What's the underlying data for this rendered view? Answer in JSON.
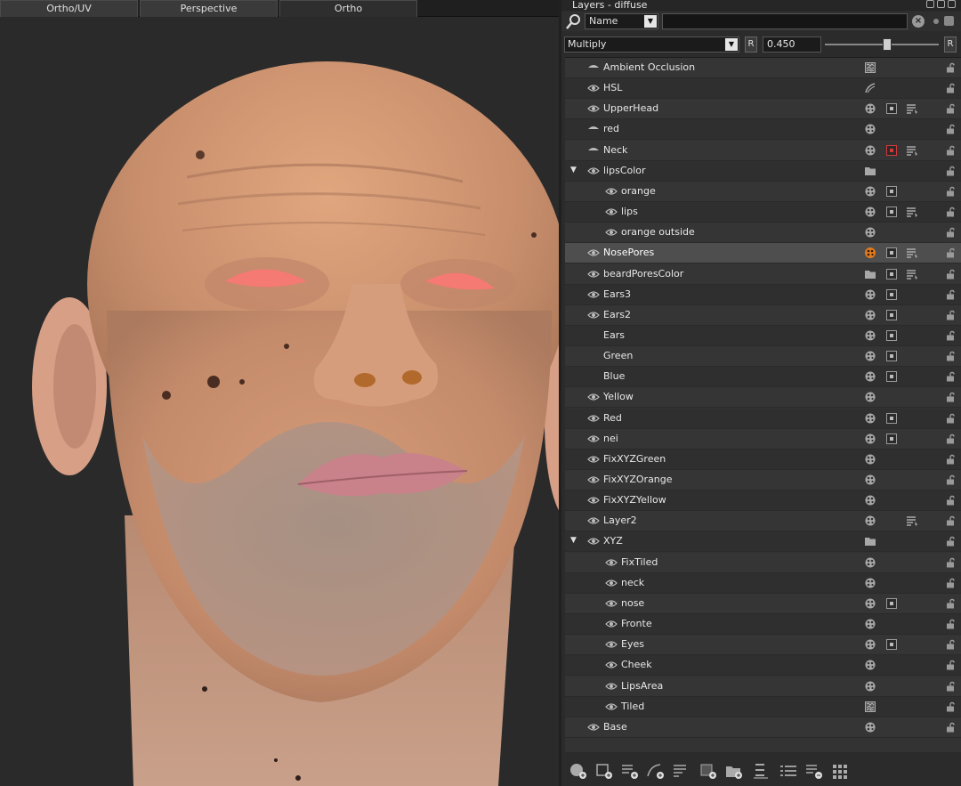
{
  "viewport": {
    "tabs": [
      {
        "label": "Ortho/UV"
      },
      {
        "label": "Perspective"
      },
      {
        "label": "Ortho"
      }
    ]
  },
  "panel": {
    "title": "Layers - diffuse",
    "filter": {
      "selected": "Name",
      "search_value": ""
    },
    "blend_mode": "Multiply",
    "reset_label": "R",
    "opacity_value": "0.450",
    "opacity_fraction": 0.45,
    "selection_color": "#4e4e4e",
    "paint_accent": "#e07a1f"
  },
  "layers": [
    {
      "name": "Ambient Occlusion",
      "indent": 0,
      "expander": "",
      "icons": [
        "texture-icon"
      ],
      "eye": "dim"
    },
    {
      "name": "HSL",
      "indent": 0,
      "expander": "",
      "icons": [
        "adjust-icon"
      ],
      "eye": "on"
    },
    {
      "name": "UpperHead",
      "indent": 0,
      "expander": "",
      "icons": [
        "paint-icon",
        "mask-icon",
        "filter-icon"
      ],
      "eye": "on"
    },
    {
      "name": "red",
      "indent": 0,
      "expander": "",
      "icons": [
        "paint-icon"
      ],
      "eye": "dim"
    },
    {
      "name": "Neck",
      "indent": 0,
      "expander": "",
      "icons": [
        "paint-icon",
        "mask-red-icon",
        "filter-icon"
      ],
      "eye": "dim"
    },
    {
      "name": "lipsColor",
      "indent": 0,
      "expander": "▼",
      "icons": [
        "folder-icon"
      ],
      "eye": "on"
    },
    {
      "name": "orange",
      "indent": 1,
      "expander": "",
      "icons": [
        "paint-icon",
        "mask-icon"
      ],
      "eye": "on"
    },
    {
      "name": "lips",
      "indent": 1,
      "expander": "",
      "icons": [
        "paint-icon",
        "mask-icon",
        "filter-icon"
      ],
      "eye": "on"
    },
    {
      "name": "orange outside",
      "indent": 1,
      "expander": "",
      "icons": [
        "paint-icon"
      ],
      "eye": "on"
    },
    {
      "name": "NosePores",
      "indent": 0,
      "expander": "",
      "icons": [
        "paint-active-icon",
        "mask-icon",
        "filter-icon"
      ],
      "eye": "on",
      "selected": true
    },
    {
      "name": "beardPoresColor",
      "indent": 0,
      "expander": "",
      "icons": [
        "folder-icon",
        "mask-icon",
        "filter-icon"
      ],
      "eye": "on"
    },
    {
      "name": "Ears3",
      "indent": 0,
      "expander": "",
      "icons": [
        "paint-icon",
        "mask-icon"
      ],
      "eye": "on"
    },
    {
      "name": "Ears2",
      "indent": 0,
      "expander": "",
      "icons": [
        "paint-icon",
        "mask-icon"
      ],
      "eye": "on"
    },
    {
      "name": "Ears",
      "indent": 0,
      "expander": "",
      "icons": [
        "paint-icon",
        "mask-icon"
      ],
      "eye": "off"
    },
    {
      "name": "Green",
      "indent": 0,
      "expander": "",
      "icons": [
        "paint-icon",
        "mask-icon"
      ],
      "eye": "off"
    },
    {
      "name": "Blue",
      "indent": 0,
      "expander": "",
      "icons": [
        "paint-icon",
        "mask-icon"
      ],
      "eye": "off"
    },
    {
      "name": "Yellow",
      "indent": 0,
      "expander": "",
      "icons": [
        "paint-icon"
      ],
      "eye": "on"
    },
    {
      "name": "Red",
      "indent": 0,
      "expander": "",
      "icons": [
        "paint-icon",
        "mask-icon"
      ],
      "eye": "on"
    },
    {
      "name": "nei",
      "indent": 0,
      "expander": "",
      "icons": [
        "paint-icon",
        "mask-icon"
      ],
      "eye": "on"
    },
    {
      "name": "FixXYZGreen",
      "indent": 0,
      "expander": "",
      "icons": [
        "paint-icon"
      ],
      "eye": "on"
    },
    {
      "name": "FixXYZOrange",
      "indent": 0,
      "expander": "",
      "icons": [
        "paint-icon"
      ],
      "eye": "on"
    },
    {
      "name": "FixXYZYellow",
      "indent": 0,
      "expander": "",
      "icons": [
        "paint-icon"
      ],
      "eye": "on"
    },
    {
      "name": "Layer2",
      "indent": 0,
      "expander": "",
      "icons": [
        "paint-icon",
        "",
        "filter-icon"
      ],
      "eye": "on"
    },
    {
      "name": "XYZ",
      "indent": 0,
      "expander": "▼",
      "icons": [
        "folder-icon"
      ],
      "eye": "on"
    },
    {
      "name": "FixTiled",
      "indent": 1,
      "expander": "",
      "icons": [
        "paint-icon"
      ],
      "eye": "on"
    },
    {
      "name": "neck",
      "indent": 1,
      "expander": "",
      "icons": [
        "paint-icon"
      ],
      "eye": "on"
    },
    {
      "name": "nose",
      "indent": 1,
      "expander": "",
      "icons": [
        "paint-icon",
        "mask-icon"
      ],
      "eye": "on"
    },
    {
      "name": "Fronte",
      "indent": 1,
      "expander": "",
      "icons": [
        "paint-icon"
      ],
      "eye": "on"
    },
    {
      "name": "Eyes",
      "indent": 1,
      "expander": "",
      "icons": [
        "paint-icon",
        "mask-icon"
      ],
      "eye": "on"
    },
    {
      "name": "Cheek",
      "indent": 1,
      "expander": "",
      "icons": [
        "paint-icon"
      ],
      "eye": "on"
    },
    {
      "name": "LipsArea",
      "indent": 1,
      "expander": "",
      "icons": [
        "paint-icon"
      ],
      "eye": "on"
    },
    {
      "name": "Tiled",
      "indent": 1,
      "expander": "",
      "icons": [
        "texture-icon"
      ],
      "eye": "on"
    },
    {
      "name": "Base",
      "indent": 0,
      "expander": "",
      "icons": [
        "paint-icon"
      ],
      "eye": "on"
    }
  ],
  "bottom_toolbar": [
    "new-paint-layer-icon",
    "new-layer-icon",
    "add-adjustment-icon",
    "add-procedural-icon",
    "add-filter-icon",
    "new-texture-layer-icon",
    "new-folder-icon",
    "merge-layers-icon",
    "add-channel-icon",
    "remove-layer-icon",
    "grid-icon"
  ]
}
